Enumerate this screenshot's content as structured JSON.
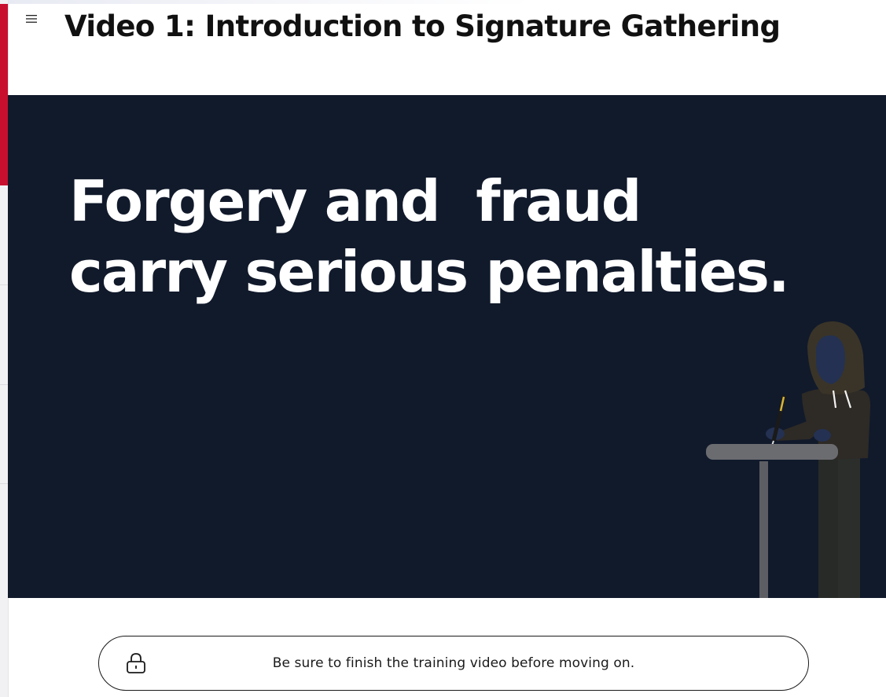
{
  "header": {
    "menu_icon": "hamburger-menu-icon",
    "title": "Video 1: Introduction to Signature Gathering"
  },
  "video": {
    "caption_line_1": "Forgery and  fraud",
    "caption_line_2": "carry serious penalties.",
    "background_color": "#111a2b",
    "illustration": "hooded-figure-signing-document-at-podium"
  },
  "notice": {
    "icon": "lock-icon",
    "message": "Be sure to finish the training video before moving on."
  },
  "colors": {
    "accent": "#c8102e",
    "text": "#111111"
  }
}
